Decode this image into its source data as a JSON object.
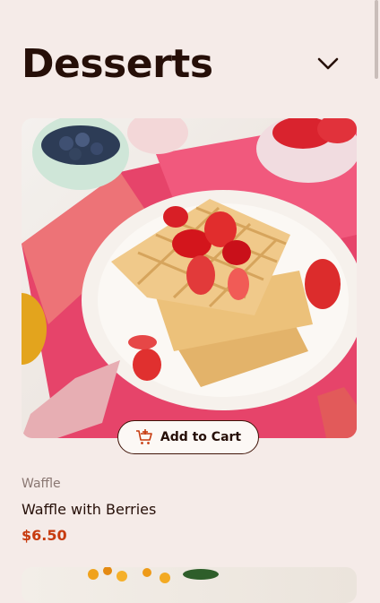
{
  "header": {
    "title": "Desserts"
  },
  "products": [
    {
      "category": "Waffle",
      "name": "Waffle with Berries",
      "price": "$6.50",
      "button_label": "Add to Cart"
    }
  ],
  "colors": {
    "background": "#f5ebe8",
    "text": "#260f08",
    "price": "#c73b0f",
    "muted": "#8a7772"
  },
  "icons": {
    "header_toggle": "chevron-down-icon",
    "cart": "add-to-cart-icon"
  }
}
